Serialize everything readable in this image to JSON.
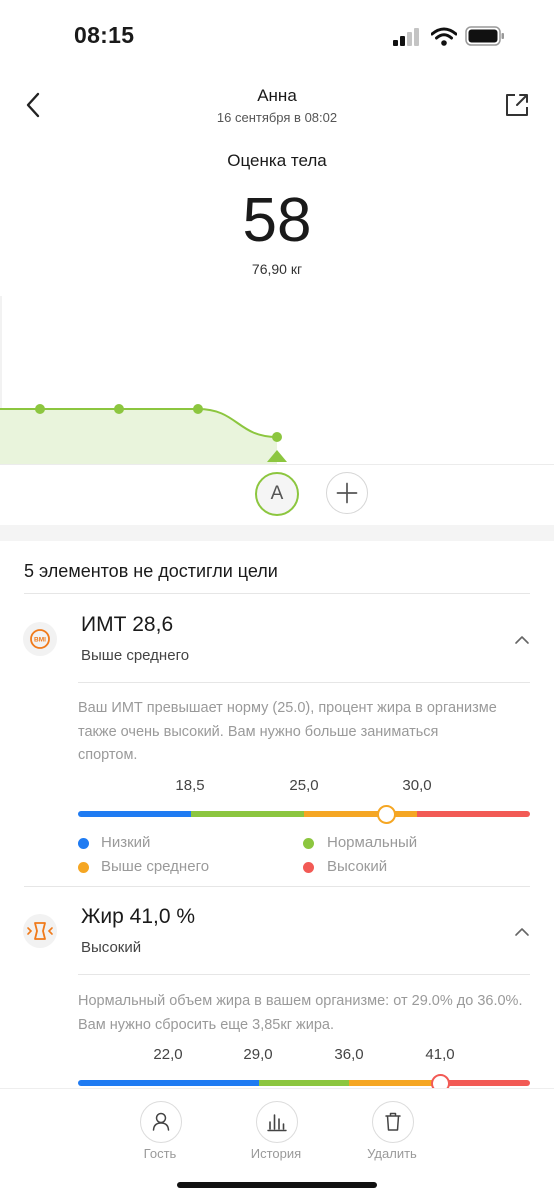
{
  "status_bar": {
    "time": "08:15"
  },
  "header": {
    "name": "Анна",
    "date": "16 сентября в 08:02"
  },
  "score": {
    "title": "Оценка тела",
    "value": "58",
    "weight": "76,90 кг"
  },
  "trend_chart": {
    "accent_color": "#8cc63f",
    "points": [
      60,
      60,
      60,
      58
    ],
    "selected_index": 3
  },
  "profiles": {
    "active_initial": "A"
  },
  "summary": {
    "title": "5 элементов не достигли цели"
  },
  "metrics": [
    {
      "icon": "bmi-icon",
      "name": "ИМТ 28,6",
      "status": "Выше среднего",
      "description": "Ваш ИМТ превышает норму (25.0), процент жира в организме также очень высокий. Вам нужно больше заниматься спортом.",
      "ticks": [
        "18,5",
        "25,0",
        "30,0"
      ],
      "value": 28.6
    },
    {
      "icon": "body-fat-icon",
      "name": "Жир 41,0 %",
      "status": "Высокий",
      "description": "Нормальный объем жира в вашем организме: от 29.0% до 36.0%. Вам нужно сбросить еще 3,85кг жира.",
      "ticks": [
        "22,0",
        "29,0",
        "36,0",
        "41,0"
      ],
      "value": 41.0
    }
  ],
  "legend": [
    {
      "label": "Низкий",
      "color": "#1f7bf2"
    },
    {
      "label": "Нормальный",
      "color": "#8cc63f"
    },
    {
      "label": "Выше среднего",
      "color": "#f5a623"
    },
    {
      "label": "Высокий",
      "color": "#f25a55"
    }
  ],
  "bottom_nav": [
    {
      "label": "Гость",
      "icon": "person-icon"
    },
    {
      "label": "История",
      "icon": "bar-chart-icon"
    },
    {
      "label": "Удалить",
      "icon": "trash-icon"
    }
  ]
}
